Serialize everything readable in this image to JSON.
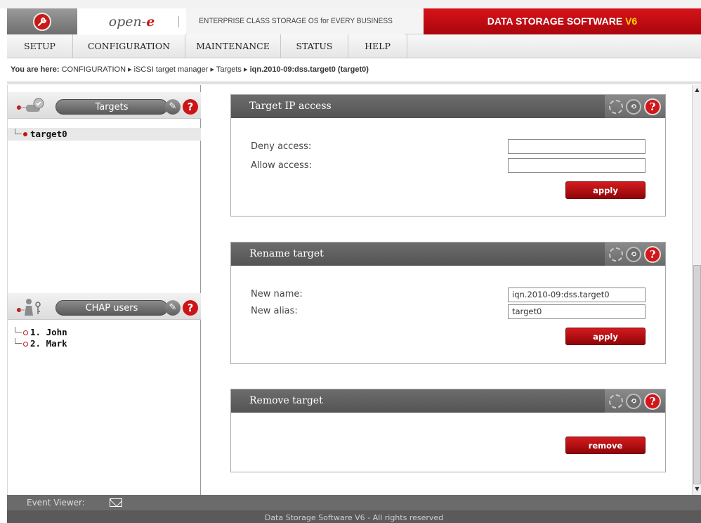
{
  "header": {
    "brand": "open-",
    "brand_e": "e",
    "tagline": "ENTERPRISE CLASS STORAGE OS for EVERY BUSINESS",
    "product": "DATA STORAGE SOFTWARE ",
    "product_version": "V6"
  },
  "menu": [
    {
      "label": "SETUP"
    },
    {
      "label": "CONFIGURATION"
    },
    {
      "label": "MAINTENANCE"
    },
    {
      "label": "STATUS"
    },
    {
      "label": "HELP"
    }
  ],
  "breadcrumb": {
    "label": "You are here:",
    "path": "CONFIGURATION ▸ iSCSI target manager ▸ Targets ▸",
    "current": "iqn.2010-09:dss.target0 (target0)"
  },
  "left_panel": {
    "targets": {
      "title": "Targets",
      "items": [
        "target0"
      ]
    },
    "chap_users": {
      "title": "CHAP users",
      "items": [
        "1. John",
        "2. Mark"
      ]
    }
  },
  "panels": {
    "ip_access": {
      "title": "Target IP access",
      "deny_label": "Deny access:",
      "deny_value": "",
      "allow_label": "Allow access:",
      "allow_value": "",
      "button": "apply"
    },
    "rename": {
      "title": "Rename target",
      "name_label": "New name:",
      "name_value": "iqn.2010-09:dss.target0",
      "alias_label": "New alias:",
      "alias_value": "target0",
      "button": "apply"
    },
    "remove": {
      "title": "Remove target",
      "button": "remove"
    }
  },
  "footer": {
    "event_viewer": "Event Viewer:",
    "copyright": "Data Storage Software V6 - All rights reserved"
  },
  "colors": {
    "brand_red": "#c31b1b",
    "panel_header": "#5f5f5f",
    "version_yellow": "#ffd400"
  }
}
